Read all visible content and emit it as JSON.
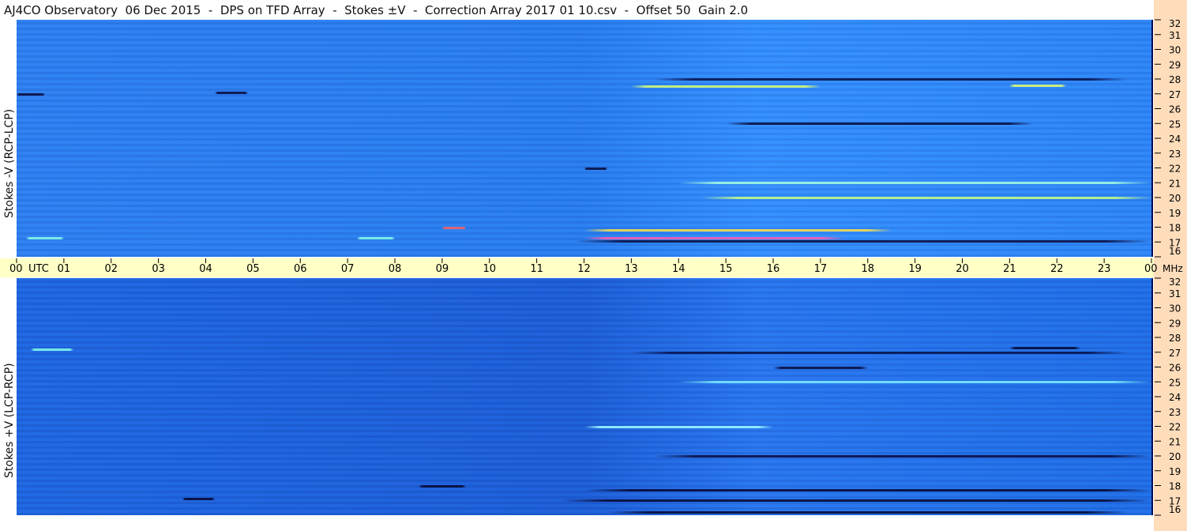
{
  "title": "AJ4CO Observatory  06 Dec 2015  -  DPS on TFD Array  -  Stokes ±V  -  Correction Array 2017 01 10.csv  -  Offset 50  Gain 2.0",
  "chart_data": [
    {
      "type": "heatmap",
      "panel": "top",
      "ylabel": "Stokes -V (RCP-LCP)",
      "x_unit": "UTC",
      "y_unit": "MHz",
      "x_ticks": [
        "00",
        "01",
        "02",
        "03",
        "04",
        "05",
        "06",
        "07",
        "08",
        "09",
        "10",
        "11",
        "12",
        "13",
        "14",
        "15",
        "16",
        "17",
        "18",
        "19",
        "20",
        "21",
        "22",
        "23",
        "00"
      ],
      "y_ticks": [
        16,
        17,
        18,
        19,
        20,
        21,
        22,
        23,
        24,
        25,
        26,
        27,
        28,
        29,
        30,
        31,
        32
      ],
      "xlim": [
        0,
        24
      ],
      "ylim": [
        16,
        32
      ],
      "features": [
        {
          "t0": 12.0,
          "t1": 18.5,
          "f": 17.8,
          "color": "#ffe040"
        },
        {
          "t0": 12.0,
          "t1": 17.5,
          "f": 17.3,
          "color": "#ff5ab0"
        },
        {
          "t0": 11.8,
          "t1": 24.0,
          "f": 17.05,
          "color": "#0a0a3a"
        },
        {
          "t0": 12.0,
          "t1": 12.5,
          "f": 22.0,
          "color": "#0a0a3a"
        },
        {
          "t0": 14.0,
          "t1": 24.0,
          "f": 21.0,
          "color": "#a8ffe0"
        },
        {
          "t0": 14.5,
          "t1": 24.0,
          "f": 20.0,
          "color": "#c8ff80"
        },
        {
          "t0": 15.0,
          "t1": 21.5,
          "f": 25.0,
          "color": "#0a0a3a"
        },
        {
          "t0": 13.0,
          "t1": 17.0,
          "f": 27.5,
          "color": "#d8ff70"
        },
        {
          "t0": 13.5,
          "t1": 23.5,
          "f": 28.0,
          "color": "#08104a"
        },
        {
          "t0": 0.0,
          "t1": 0.6,
          "f": 27.0,
          "color": "#0a0a3a"
        },
        {
          "t0": 4.2,
          "t1": 4.9,
          "f": 27.1,
          "color": "#0a0a3a"
        },
        {
          "t0": 21.0,
          "t1": 22.2,
          "f": 27.6,
          "color": "#e0ff70"
        },
        {
          "t0": 0.2,
          "t1": 1.0,
          "f": 17.3,
          "color": "#88ffe8"
        },
        {
          "t0": 7.2,
          "t1": 8.0,
          "f": 17.3,
          "color": "#88ffe8"
        },
        {
          "t0": 9.0,
          "t1": 9.5,
          "f": 18.0,
          "color": "#ff6060"
        }
      ]
    },
    {
      "type": "heatmap",
      "panel": "bottom",
      "ylabel": "Stokes +V (LCP-RCP)",
      "x_unit": "UTC",
      "y_unit": "MHz",
      "x_ticks": [
        "00",
        "01",
        "02",
        "03",
        "04",
        "05",
        "06",
        "07",
        "08",
        "09",
        "10",
        "11",
        "12",
        "13",
        "14",
        "15",
        "16",
        "17",
        "18",
        "19",
        "20",
        "21",
        "22",
        "23",
        "00"
      ],
      "y_ticks": [
        16,
        17,
        18,
        19,
        20,
        21,
        22,
        23,
        24,
        25,
        26,
        27,
        28,
        29,
        30,
        31,
        32
      ],
      "xlim": [
        0,
        24
      ],
      "ylim": [
        16,
        32
      ],
      "features": [
        {
          "t0": 11.5,
          "t1": 24.0,
          "f": 17.0,
          "color": "#06062e"
        },
        {
          "t0": 12.0,
          "t1": 24.0,
          "f": 17.7,
          "color": "#06062e"
        },
        {
          "t0": 12.5,
          "t1": 23.5,
          "f": 16.2,
          "color": "#06062e"
        },
        {
          "t0": 3.5,
          "t1": 4.2,
          "f": 17.1,
          "color": "#06062e"
        },
        {
          "t0": 8.5,
          "t1": 9.5,
          "f": 18.0,
          "color": "#06062e"
        },
        {
          "t0": 13.5,
          "t1": 24.0,
          "f": 20.0,
          "color": "#0a0a3a"
        },
        {
          "t0": 12.0,
          "t1": 16.0,
          "f": 22.0,
          "color": "#9cffff"
        },
        {
          "t0": 13.0,
          "t1": 23.5,
          "f": 27.0,
          "color": "#08104a"
        },
        {
          "t0": 21.0,
          "t1": 22.5,
          "f": 27.3,
          "color": "#06062e"
        },
        {
          "t0": 0.3,
          "t1": 1.2,
          "f": 27.2,
          "color": "#88ffe8"
        },
        {
          "t0": 16.0,
          "t1": 18.0,
          "f": 26.0,
          "color": "#0a0a3a"
        },
        {
          "t0": 14.0,
          "t1": 24.0,
          "f": 25.0,
          "color": "#7ff0ff"
        }
      ]
    }
  ]
}
